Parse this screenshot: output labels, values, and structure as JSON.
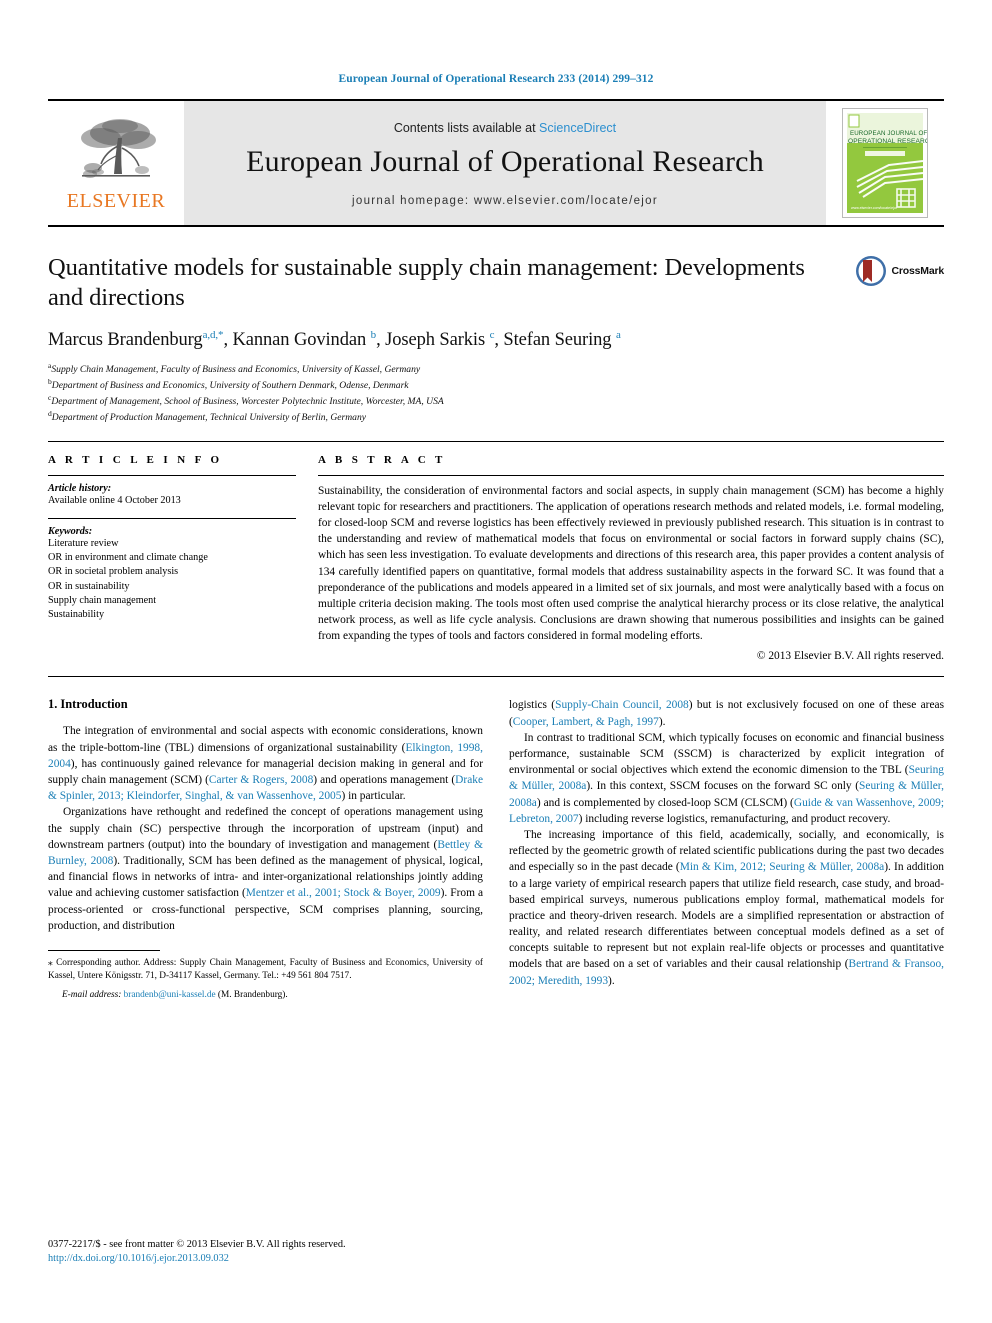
{
  "running_head": "European Journal of Operational Research 233 (2014) 299–312",
  "masthead": {
    "publisher_name": "ELSEVIER",
    "contents_prefix": "Contents lists available at ",
    "contents_link": "ScienceDirect",
    "journal_title": "European Journal of Operational Research",
    "homepage": "journal homepage: www.elsevier.com/locate/ejor",
    "cover_title_line1": "EUROPEAN JOURNAL OF",
    "cover_title_line2": "OPERATIONAL RESEARCH"
  },
  "article": {
    "title": "Quantitative models for sustainable supply chain management: Developments and directions",
    "authors_html": "Marcus Brandenburg<sup>a,d,</sup><sup>*</sup>, Kannan Govindan <sup>b</sup>, Joseph Sarkis <sup>c</sup>, Stefan Seuring <sup>a</sup>",
    "affiliations": [
      {
        "marker": "a",
        "text": "Supply Chain Management, Faculty of Business and Economics, University of Kassel, Germany"
      },
      {
        "marker": "b",
        "text": "Department of Business and Economics, University of Southern Denmark, Odense, Denmark"
      },
      {
        "marker": "c",
        "text": "Department of Management, School of Business, Worcester Polytechnic Institute, Worcester, MA, USA"
      },
      {
        "marker": "d",
        "text": "Department of Production Management, Technical University of Berlin, Germany"
      }
    ],
    "crossmark_label": "CrossMark"
  },
  "article_info": {
    "heading": "A R T I C L E  I N F O",
    "history_label": "Article history:",
    "history_value": "Available online 4 October 2013",
    "keywords_label": "Keywords:",
    "keywords": [
      "Literature review",
      "OR in environment and climate change",
      "OR in societal problem analysis",
      "OR in sustainability",
      "Supply chain management",
      "Sustainability"
    ]
  },
  "abstract": {
    "heading": "A B S T R A C T",
    "text": "Sustainability, the consideration of environmental factors and social aspects, in supply chain management (SCM) has become a highly relevant topic for researchers and practitioners. The application of operations research methods and related models, i.e. formal modeling, for closed-loop SCM and reverse logistics has been effectively reviewed in previously published research. This situation is in contrast to the understanding and review of mathematical models that focus on environmental or social factors in forward supply chains (SC), which has seen less investigation. To evaluate developments and directions of this research area, this paper provides a content analysis of 134 carefully identified papers on quantitative, formal models that address sustainability aspects in the forward SC. It was found that a preponderance of the publications and models appeared in a limited set of six journals, and most were analytically based with a focus on multiple criteria decision making. The tools most often used comprise the analytical hierarchy process or its close relative, the analytical network process, as well as life cycle analysis. Conclusions are drawn showing that numerous possibilities and insights can be gained from expanding the types of tools and factors considered in formal modeling efforts.",
    "copyright": "© 2013 Elsevier B.V. All rights reserved."
  },
  "section": {
    "number_title": "1. Introduction"
  },
  "body": {
    "left_paragraphs": [
      {
        "segments": [
          {
            "t": "The integration of environmental and social aspects with economic considerations, known as the triple-bottom-line (TBL) dimensions of organizational sustainability (",
            "c": false
          },
          {
            "t": "Elkington, 1998, 2004",
            "c": true
          },
          {
            "t": "), has continuously gained relevance for managerial decision making in general and for supply chain management (SCM) (",
            "c": false
          },
          {
            "t": "Carter & Rogers, 2008",
            "c": true
          },
          {
            "t": ") and operations management (",
            "c": false
          },
          {
            "t": "Drake & Spinler, 2013; Kleindorfer, Singhal, & van Wassenhove, 2005",
            "c": true
          },
          {
            "t": ") in particular.",
            "c": false
          }
        ]
      },
      {
        "segments": [
          {
            "t": "Organizations have rethought and redefined the concept of operations management using the supply chain (SC) perspective through the incorporation of upstream (input) and downstream partners (output) into the boundary of investigation and management (",
            "c": false
          },
          {
            "t": "Bettley & Burnley, 2008",
            "c": true
          },
          {
            "t": "). Traditionally, SCM has been defined as the management of physical, logical, and financial flows in networks of intra- and inter-organizational relationships jointly adding value and achieving customer satisfaction (",
            "c": false
          },
          {
            "t": "Mentzer et al., 2001; Stock & Boyer, 2009",
            "c": true
          },
          {
            "t": "). From a process-oriented or cross-functional perspective, SCM comprises planning, sourcing, production, and distribution",
            "c": false
          }
        ]
      }
    ],
    "right_paragraphs": [
      {
        "indent": false,
        "segments": [
          {
            "t": "logistics (",
            "c": false
          },
          {
            "t": "Supply-Chain Council, 2008",
            "c": true
          },
          {
            "t": ") but is not exclusively focused on one of these areas (",
            "c": false
          },
          {
            "t": "Cooper, Lambert, & Pagh, 1997",
            "c": true
          },
          {
            "t": ").",
            "c": false
          }
        ]
      },
      {
        "indent": true,
        "segments": [
          {
            "t": "In contrast to traditional SCM, which typically focuses on economic and financial business performance, sustainable SCM (SSCM) is characterized by explicit integration of environmental or social objectives which extend the economic dimension to the TBL (",
            "c": false
          },
          {
            "t": "Seuring & Müller, 2008a",
            "c": true
          },
          {
            "t": "). In this context, SSCM focuses on the forward SC only (",
            "c": false
          },
          {
            "t": "Seuring & Müller, 2008a",
            "c": true
          },
          {
            "t": ") and is complemented by closed-loop SCM (CLSCM) (",
            "c": false
          },
          {
            "t": "Guide & van Wassenhove, 2009; Lebreton, 2007",
            "c": true
          },
          {
            "t": ") including reverse logistics, remanufacturing, and product recovery.",
            "c": false
          }
        ]
      },
      {
        "indent": true,
        "segments": [
          {
            "t": "The increasing importance of this field, academically, socially, and economically, is reflected by the geometric growth of related scientific publications during the past two decades and especially so in the past decade (",
            "c": false
          },
          {
            "t": "Min & Kim, 2012; Seuring & Müller, 2008a",
            "c": true
          },
          {
            "t": "). In addition to a large variety of empirical research papers that utilize field research, case study, and broad-based empirical surveys, numerous publications employ formal, mathematical models for practice and theory-driven research. Models are a simplified representation or abstraction of reality, and related research differentiates between conceptual models defined as a set of concepts suitable to represent but not explain real-life objects or processes and quantitative models that are based on a set of variables and their causal relationship (",
            "c": false
          },
          {
            "t": "Bertrand & Fransoo, 2002; Meredith, 1993",
            "c": true
          },
          {
            "t": ").",
            "c": false
          }
        ]
      }
    ]
  },
  "footnotes": {
    "corresponding": "⁎ Corresponding author. Address: Supply Chain Management, Faculty of Business and Economics, University of Kassel, Untere Königsstr. 71, D-34117 Kassel, Germany. Tel.: +49 561 804 7517.",
    "email_label": "E-mail address:",
    "email_link": "brandenb@uni-kassel.de",
    "email_suffix": " (M. Brandenburg)."
  },
  "bottom_meta": {
    "issn_line": "0377-2217/$ - see front matter © 2013 Elsevier B.V. All rights reserved.",
    "doi": "http://dx.doi.org/10.1016/j.ejor.2013.09.032"
  },
  "colors": {
    "link_blue": "#1a7eb5",
    "sciencedirect_blue": "#2c8fcf",
    "elsevier_orange": "#E87722",
    "masthead_grey": "#e6e6e6",
    "cover_green": "#8cc63f"
  }
}
